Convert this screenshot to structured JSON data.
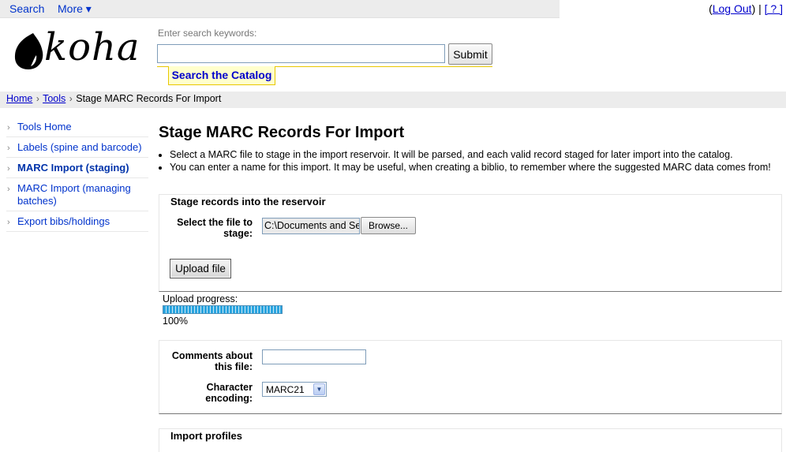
{
  "topnav": {
    "search": "Search",
    "more": "More ▾",
    "open_paren": "(",
    "logout": "Log Out",
    "separator": ") | ",
    "help": "[ ? ]"
  },
  "logo": {
    "text": "koha"
  },
  "search": {
    "hint": "Enter search keywords:",
    "value": "",
    "submit": "Submit",
    "catalog_tab": "Search the Catalog"
  },
  "breadcrumb": {
    "home": "Home",
    "sep": "›",
    "tools": "Tools",
    "current": "Stage MARC Records For Import"
  },
  "sidebar": {
    "items": [
      {
        "label": "Tools Home"
      },
      {
        "label": "Labels (spine and barcode)"
      },
      {
        "label": "MARC Import (staging)"
      },
      {
        "label": "MARC Import (managing batches)"
      },
      {
        "label": "Export bibs/holdings"
      }
    ]
  },
  "main": {
    "title": "Stage MARC Records For Import",
    "intro": [
      "Select a MARC file to stage in the import reservoir. It will be parsed, and each valid record staged for later import into the catalog.",
      "You can enter a name for this import. It may be useful, when creating a biblio, to remember where the suggested MARC data comes from!"
    ]
  },
  "stage": {
    "legend": "Stage records into the reservoir",
    "file_label": "Select the file to stage:",
    "file_value": "C:\\Documents and Se",
    "browse": "Browse...",
    "upload": "Upload file"
  },
  "progress": {
    "label": "Upload progress:",
    "value": 1.0,
    "percent_text": "100%"
  },
  "comments": {
    "label": "Comments about this file:",
    "value": "",
    "encoding_label": "Character encoding:",
    "encoding_value": "MARC21"
  },
  "profiles": {
    "legend": "Import profiles"
  }
}
